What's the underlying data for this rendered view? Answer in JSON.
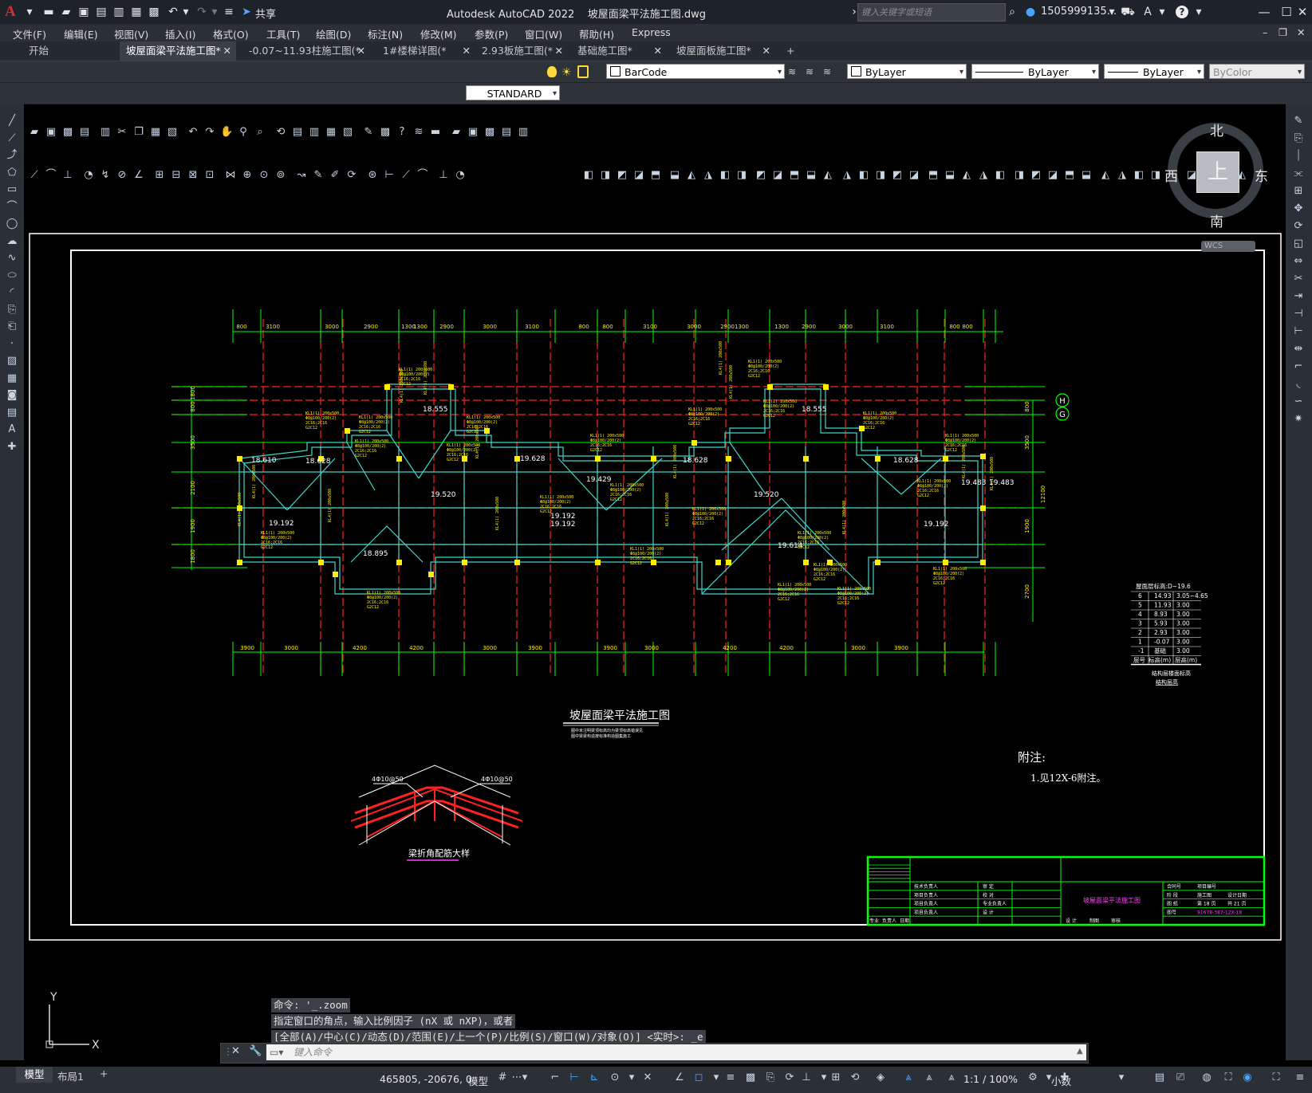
{
  "app": {
    "logo": "A",
    "share_label": "共享",
    "title": "Autodesk AutoCAD 2022    坡屋面梁平法施工图.dwg",
    "search_placeholder": "键入关键字或短语",
    "user": "1505999135...",
    "help": "?"
  },
  "menu": [
    "文件(F)",
    "编辑(E)",
    "视图(V)",
    "插入(I)",
    "格式(O)",
    "工具(T)",
    "绘图(D)",
    "标注(N)",
    "修改(M)",
    "参数(P)",
    "窗口(W)",
    "帮助(H)",
    "Express"
  ],
  "tabs": [
    {
      "label": "开始",
      "active": false,
      "closable": false
    },
    {
      "label": "坡屋面梁平法施工图*",
      "active": true,
      "closable": true
    },
    {
      "label": "-0.07~11.93柱施工图(*",
      "active": false,
      "closable": true
    },
    {
      "label": "1#楼梯详图(*",
      "active": false,
      "closable": true
    },
    {
      "label": "2.93板施工图(*",
      "active": false,
      "closable": true
    },
    {
      "label": "基础施工图*",
      "active": false,
      "closable": true
    },
    {
      "label": "坡屋面板施工图*",
      "active": false,
      "closable": true
    }
  ],
  "toolbar": {
    "layer_combo": "BarCode",
    "color_combo": "ByLayer",
    "linetype_combo": "ByLayer",
    "lineweight_combo": "ByLayer",
    "plotstyle_combo": "ByColor",
    "textstyle_combo": "STANDARD"
  },
  "viewcube": {
    "north": "北",
    "south": "南",
    "east": "东",
    "west": "西",
    "face": "上",
    "wcs": "WCS"
  },
  "drawing": {
    "title": "坡屋面梁平法施工图",
    "subtitle_lines": [
      "图中未注明梁顶标高均为梁顶标高错误见",
      "图中梁梁构造按标准构造图集施工"
    ],
    "note_title": "附注:",
    "note_1": "1.见12X-6附注。",
    "detail_title": "梁折角配筋大样",
    "detail_label_left": "4Φ10@50",
    "detail_label_right": "4Φ10@50",
    "axis_h": "H",
    "axis_g": "G",
    "top_dims": [
      "800",
      "3100",
      "3000",
      "2900",
      "1300",
      "1300",
      "2900",
      "3000",
      "3100",
      "800",
      "800",
      "3100",
      "3000",
      "2900",
      "1300",
      "1300",
      "2900",
      "3000",
      "3100",
      "800",
      "800"
    ],
    "bottom_dims": [
      "3900",
      "3000",
      "4200",
      "4200",
      "3000",
      "3900",
      "3900",
      "3000",
      "4200",
      "4200",
      "3000",
      "3900"
    ],
    "left_dims": [
      "1800",
      "800",
      "3500",
      "2100",
      "1900",
      "1800"
    ],
    "right_dims": [
      "800",
      "3500",
      "12100",
      "1900",
      "2700"
    ],
    "elevations": [
      "18.610",
      "18.628",
      "18.555",
      "19.628",
      "19.429",
      "19.520",
      "19.192",
      "19.192",
      "19.520",
      "19.614",
      "18.628",
      "18.555",
      "18.628",
      "19.483",
      "19.483",
      "19.192",
      "18.895",
      "19.192"
    ],
    "level_table": {
      "header": [
        "层号",
        "标高(m)",
        "层高(m)"
      ],
      "title_row": "屋面层标高:D~19.6",
      "rows": [
        [
          "6",
          "14.93",
          "3.05~4.65"
        ],
        [
          "5",
          "11.93",
          "3.00"
        ],
        [
          "4",
          "8.93",
          "3.00"
        ],
        [
          "3",
          "5.93",
          "3.00"
        ],
        [
          "2",
          "2.93",
          "3.00"
        ],
        [
          "1",
          "-0.07",
          "3.00"
        ],
        [
          "-1",
          "基础",
          "3.00"
        ]
      ],
      "caption_1": "结构层楼面标高",
      "caption_2": "结构层高"
    },
    "titleblock": {
      "drawing_name": "坡屋面梁平法施工图",
      "left_rows": [
        "技术负责人",
        "项目负责人",
        "项目负责人",
        "项目负责人"
      ],
      "mid_rows": [
        "审  定",
        "校  对",
        "专业负责人",
        "设  计"
      ],
      "right_rows": [
        [
          "合同号",
          "项目编号"
        ],
        [
          "阶  段",
          "施工图",
          "设计日期"
        ],
        [
          "图  纸",
          "第 18 页",
          "共 21 页"
        ],
        [
          "图号",
          "91678-387-12X-18"
        ]
      ],
      "bottom_row": [
        "专业",
        "负责人",
        "日期",
        "设  计",
        "制图",
        "审核"
      ]
    }
  },
  "ucs": {
    "y": "Y",
    "x": "X"
  },
  "command": {
    "history": [
      "命令: '_.zoom",
      "指定窗口的角点，输入比例因子 (nX 或 nXP)，或者",
      "[全部(A)/中心(C)/动态(D)/范围(E)/上一个(P)/比例(S)/窗口(W)/对象(O)] <实时>: _e"
    ],
    "input_placeholder": "键入命令"
  },
  "status": {
    "tab_model": "模型",
    "tab_layout1": "布局1",
    "coords": "465805, -20676, 0",
    "model_label": "模型",
    "scale": "1:1 / 100%",
    "units": "小数"
  }
}
